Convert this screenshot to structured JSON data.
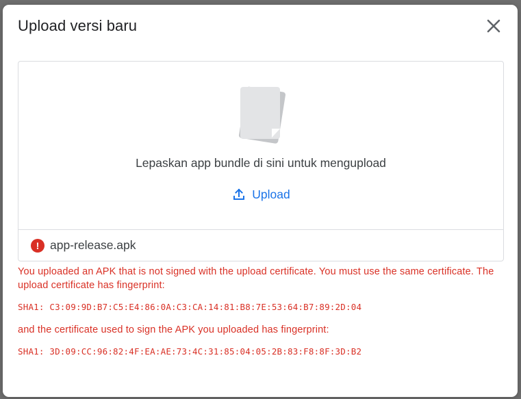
{
  "dialog": {
    "title": "Upload versi baru",
    "close_icon": "close-icon"
  },
  "dropzone": {
    "illustration_icon": "document-icon",
    "instruction": "Lepaskan app bundle di sini untuk mengupload",
    "upload_label": "Upload",
    "upload_icon": "upload-icon"
  },
  "file": {
    "name": "app-release.apk",
    "status_icon": "error-icon",
    "status_symbol": "!"
  },
  "error": {
    "message": "You uploaded an APK that is not signed with the upload certificate. You must use the same certificate. The upload certificate has fingerprint:",
    "expected_fingerprint": "SHA1: C3:09:9D:B7:C5:E4:86:0A:C3:CA:14:81:B8:7E:53:64:B7:89:2D:04",
    "message2": "and the certificate used to sign the APK you uploaded has fingerprint:",
    "actual_fingerprint": "SHA1: 3D:09:CC:96:82:4F:EA:AE:73:4C:31:85:04:05:2B:83:F8:8F:3D:B2"
  },
  "colors": {
    "accent": "#1a73e8",
    "error": "#d93025",
    "text": "#202124",
    "border": "#dadce0"
  }
}
